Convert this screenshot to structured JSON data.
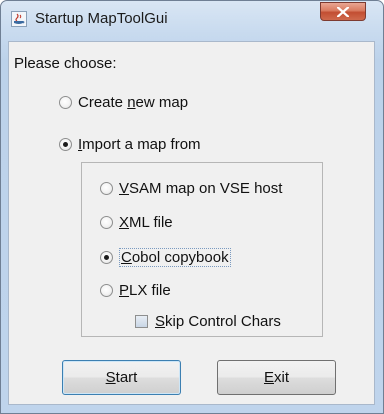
{
  "window": {
    "title": "Startup MapToolGui",
    "icon": "java-app-icon",
    "close_icon": "close-x-icon"
  },
  "prompt": "Please choose:",
  "options": {
    "create_new_map": {
      "label": "Create new map",
      "mnemonic": "n",
      "selected": false
    },
    "import_map": {
      "label": "Import a map from",
      "mnemonic": "I",
      "selected": true
    }
  },
  "import_sources": [
    {
      "label": "VSAM map on VSE host",
      "mnemonic": "V",
      "selected": false
    },
    {
      "label": "XML file",
      "mnemonic": "X",
      "selected": false
    },
    {
      "label": "Cobol copybook",
      "mnemonic": "C",
      "selected": true
    },
    {
      "label": "PLX file",
      "mnemonic": "P",
      "selected": false
    }
  ],
  "skip_control_chars": {
    "label": "Skip Control Chars",
    "mnemonic": "S",
    "checked": false
  },
  "buttons": {
    "start": {
      "label": "Start",
      "mnemonic": "S"
    },
    "exit": {
      "label": "Exit",
      "mnemonic": "E"
    }
  }
}
